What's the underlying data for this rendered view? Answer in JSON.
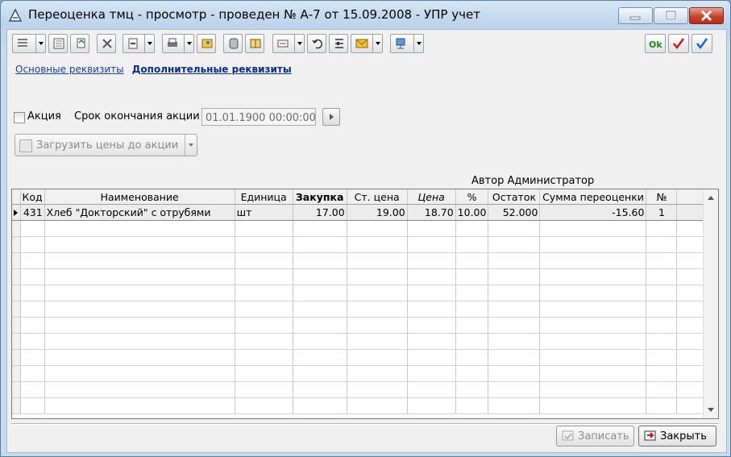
{
  "window": {
    "title": "Переоценка тмц - просмотр - проведен № А-7 от 15.09.2008 - УПР учет"
  },
  "toolbar": {
    "icons": [
      "list-icon",
      "form-icon",
      "copy-icon",
      "delete-icon",
      "import-icon",
      "print-icon",
      "picture-icon",
      "calculator-icon",
      "book-icon",
      "card-icon",
      "undo-icon",
      "structure-icon",
      "envelope-icon",
      "network-icon",
      "ok-icon",
      "check-red-icon",
      "check-blue-icon"
    ],
    "ok_label": "Ok"
  },
  "links": {
    "main": "Основные реквизиты",
    "extra": "Дополнительные реквизиты"
  },
  "promo": {
    "checkbox_label": "Акция",
    "end_label": "Срок окончания акции",
    "end_value": "01.01.1900 00:00:00",
    "checked": false
  },
  "load_button": {
    "label": "Загрузить цены до акции"
  },
  "author": {
    "text": "Автор Администратор"
  },
  "table": {
    "columns": [
      "Код",
      "Наименование",
      "Единица",
      "Закупка",
      "Ст. цена",
      "Цена",
      "%",
      "Остаток",
      "Сумма переоценки",
      "№"
    ],
    "rows": [
      [
        "431",
        "Хлеб \"Докторский\" с отрубями",
        "шт",
        "17.00",
        "19.00",
        "18.70",
        "10.00",
        "52.000",
        "-15.60",
        "1"
      ]
    ]
  },
  "buttons": {
    "save": "Записать",
    "close": "Закрыть"
  },
  "colors": {
    "ok": "#1a8a1a",
    "check_red": "#d01818",
    "check_blue": "#1f5fd0",
    "link": "#1a3fa8"
  }
}
